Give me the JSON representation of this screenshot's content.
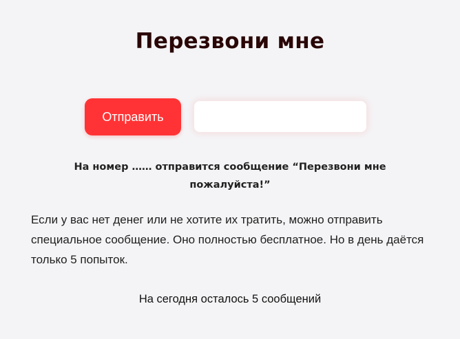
{
  "page": {
    "title": "Перезвони мне"
  },
  "form": {
    "send_label": "Отправить",
    "phone_value": "",
    "phone_placeholder": ""
  },
  "notice": "На номер …… отправится сообщение “Перезвони мне пожалуйста!”",
  "description": "Если у вас нет денег или не хотите их тратить, можно отправить специальное сообщение. Оно полностью бесплатное. Но в день даётся только 5 попыток.",
  "remaining": "На сегодня осталось 5 сообщений",
  "colors": {
    "accent": "#ff3335",
    "title": "#2a0606",
    "background": "#f4f4f6"
  }
}
